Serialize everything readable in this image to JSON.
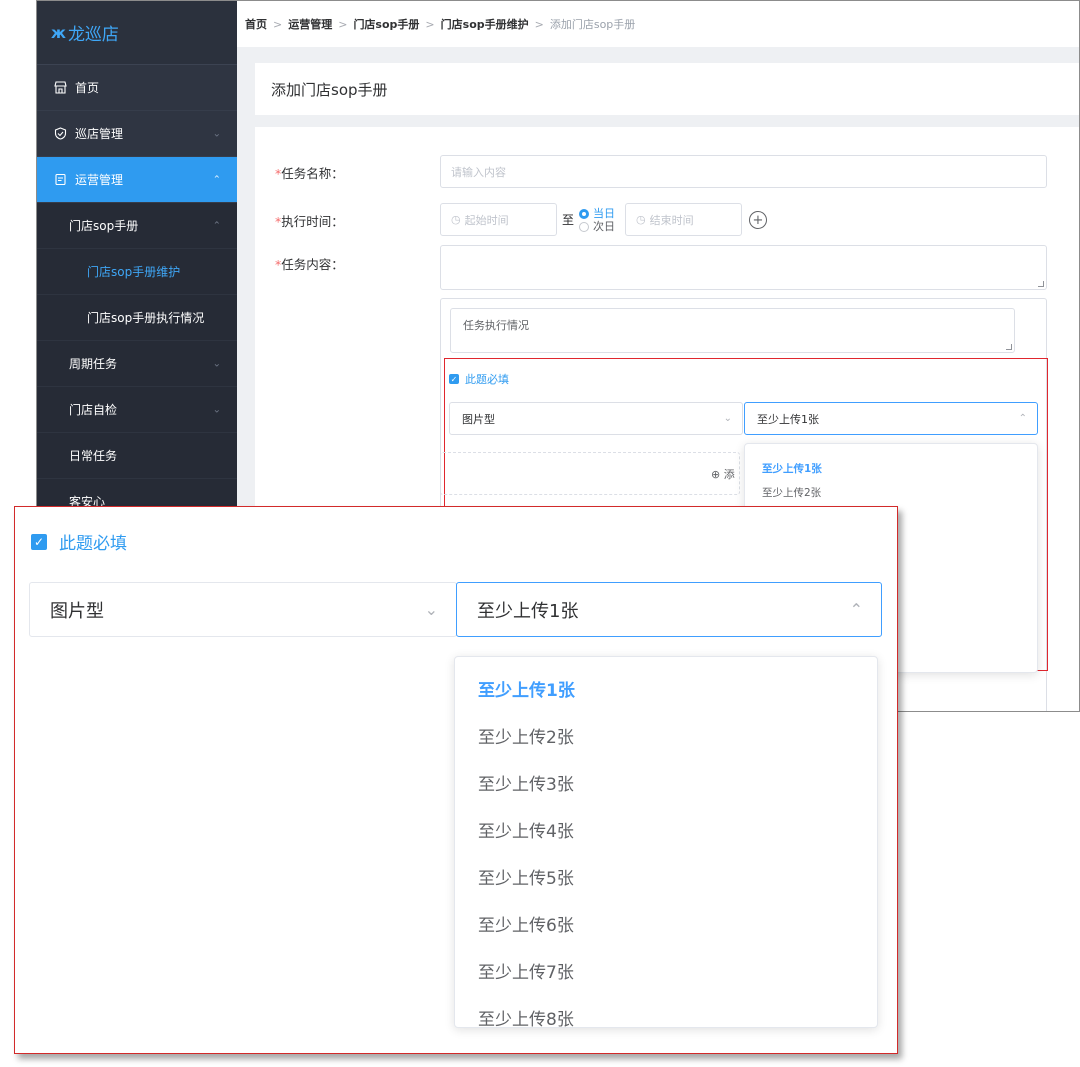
{
  "app": {
    "logo_text": "龙巡店",
    "logo_icon": "link-icon",
    "sidebar": [
      {
        "label": "首页",
        "icon": "store-icon"
      },
      {
        "label": "巡店管理",
        "icon": "shield-icon"
      },
      {
        "label": "运营管理",
        "icon": "clipboard-icon"
      }
    ],
    "sub_items": [
      {
        "label": "门店sop手册"
      },
      {
        "label": "门店sop手册维护"
      },
      {
        "label": "门店sop手册执行情况"
      },
      {
        "label": "周期任务"
      },
      {
        "label": "门店自检"
      },
      {
        "label": "日常任务"
      },
      {
        "label": "客安心"
      }
    ],
    "breadcrumb": [
      "首页",
      "运营管理",
      "门店sop手册",
      "门店sop手册维护",
      "添加门店sop手册"
    ],
    "page_title": "添加门店sop手册"
  },
  "form": {
    "task_name_label": "任务名称：",
    "task_name_placeholder": "请输入内容",
    "exec_time_label": "执行时间：",
    "start_placeholder": "起始时间",
    "to_label": "至",
    "radio_today": "当日",
    "radio_nextday": "次日",
    "end_placeholder": "结束时间",
    "content_label": "任务内容：",
    "inner_textarea": "任务执行情况",
    "required_label": "此题必填",
    "type_select": "图片型",
    "upload_select": "至少上传1张",
    "add_label": "添"
  },
  "dropdown_small": [
    "至少上传1张",
    "至少上传2张"
  ],
  "zoom": {
    "required_label": "此题必填",
    "type_select": "图片型",
    "upload_select": "至少上传1张",
    "options": [
      "至少上传1张",
      "至少上传2张",
      "至少上传3张",
      "至少上传4张",
      "至少上传5张",
      "至少上传6张",
      "至少上传7张",
      "至少上传8张"
    ]
  },
  "colors": {
    "sidebar_bg": "#2f3542",
    "accent": "#2f9bf0",
    "required_star": "#f56c6c",
    "highlight_box": "#e0262e"
  }
}
